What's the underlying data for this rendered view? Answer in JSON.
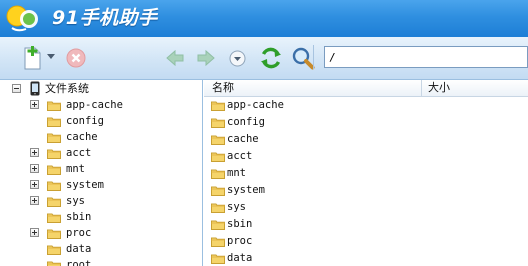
{
  "app": {
    "title": "91手机助手"
  },
  "toolbar": {
    "path_value": "/",
    "icons": [
      "new-file-icon",
      "dropdown-arrow-icon",
      "delete-icon",
      "back-icon",
      "forward-icon",
      "history-dropdown-icon",
      "refresh-icon",
      "search-icon"
    ]
  },
  "tree": {
    "root_label": "文件系统",
    "items": [
      {
        "label": "app-cache",
        "expandable": true
      },
      {
        "label": "config",
        "expandable": false
      },
      {
        "label": "cache",
        "expandable": false
      },
      {
        "label": "acct",
        "expandable": true
      },
      {
        "label": "mnt",
        "expandable": true
      },
      {
        "label": "system",
        "expandable": true
      },
      {
        "label": "sys",
        "expandable": true
      },
      {
        "label": "sbin",
        "expandable": false
      },
      {
        "label": "proc",
        "expandable": true
      },
      {
        "label": "data",
        "expandable": false
      },
      {
        "label": "root",
        "expandable": false
      }
    ]
  },
  "list": {
    "columns": {
      "name": "名称",
      "size": "大小"
    },
    "rows": [
      {
        "name": "app-cache",
        "size": ""
      },
      {
        "name": "config",
        "size": ""
      },
      {
        "name": "cache",
        "size": ""
      },
      {
        "name": "acct",
        "size": ""
      },
      {
        "name": "mnt",
        "size": ""
      },
      {
        "name": "system",
        "size": ""
      },
      {
        "name": "sys",
        "size": ""
      },
      {
        "name": "sbin",
        "size": ""
      },
      {
        "name": "proc",
        "size": ""
      },
      {
        "name": "data",
        "size": ""
      }
    ]
  },
  "colors": {
    "titlebar": "#2f8fe0",
    "toolbar": "#d2e5f6",
    "folder": "#f2cf5b",
    "accent_green": "#3fae2a"
  }
}
